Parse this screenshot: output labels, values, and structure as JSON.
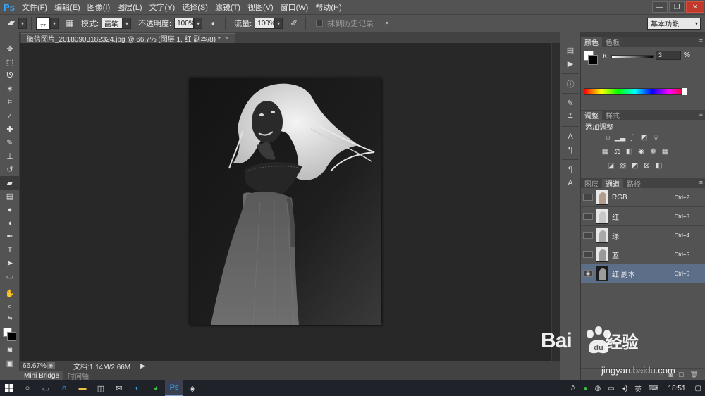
{
  "app": {
    "logo": "Ps"
  },
  "menu": {
    "items": [
      "文件(F)",
      "编辑(E)",
      "图像(I)",
      "图层(L)",
      "文字(Y)",
      "选择(S)",
      "滤镜(T)",
      "视图(V)",
      "窗口(W)",
      "帮助(H)"
    ]
  },
  "window_controls": {
    "minimize": "—",
    "restore": "❐",
    "close": "✕"
  },
  "options": {
    "brush_size": "77",
    "mode_label": "模式:",
    "mode_value": "画笔",
    "opacity_label": "不透明度:",
    "opacity_value": "100%",
    "flow_label": "流量:",
    "flow_value": "100%",
    "erase_history_label": "抹到历史记录",
    "workspace": "基本功能"
  },
  "document": {
    "tab_title": "微信图片_20180903182324.jpg @ 66.7% (图层 1, 红 副本/8) *",
    "tab_close": "×"
  },
  "status": {
    "zoom": "66.67%",
    "doc_info": "文档:1.14M/2.66M"
  },
  "bottom_tabs": [
    "Mini Bridge",
    "时间轴"
  ],
  "color_panel": {
    "tabs": [
      "颜色",
      "色板"
    ],
    "channel_label": "K",
    "value": "3",
    "unit": "%"
  },
  "adjustments_panel": {
    "tabs": [
      "调整",
      "样式"
    ],
    "title": "添加调整"
  },
  "channels_panel": {
    "tabs": [
      "图层",
      "通道",
      "路径"
    ],
    "rows": [
      {
        "name": "RGB",
        "shortcut": "Ctrl+2"
      },
      {
        "name": "红",
        "shortcut": "Ctrl+3"
      },
      {
        "name": "绿",
        "shortcut": "Ctrl+4"
      },
      {
        "name": "蓝",
        "shortcut": "Ctrl+5"
      },
      {
        "name": "红 副本",
        "shortcut": "Ctrl+6"
      }
    ]
  },
  "taskbar": {
    "input_method": "英",
    "time": "18:51"
  },
  "watermark": {
    "brand": "Bai",
    "brand_suffix": "经验",
    "url": "jingyan.baidu.com"
  },
  "icons": {
    "toolbox": [
      "move-icon",
      "marquee-icon",
      "lasso-icon",
      "magic-wand-icon",
      "crop-icon",
      "eyedropper-icon",
      "healing-icon",
      "brush-icon",
      "stamp-icon",
      "history-brush-icon",
      "eraser-icon",
      "gradient-icon",
      "blur-icon",
      "dodge-icon",
      "pen-icon",
      "type-icon",
      "path-select-icon",
      "shape-icon",
      "hand-icon",
      "zoom-icon"
    ]
  }
}
